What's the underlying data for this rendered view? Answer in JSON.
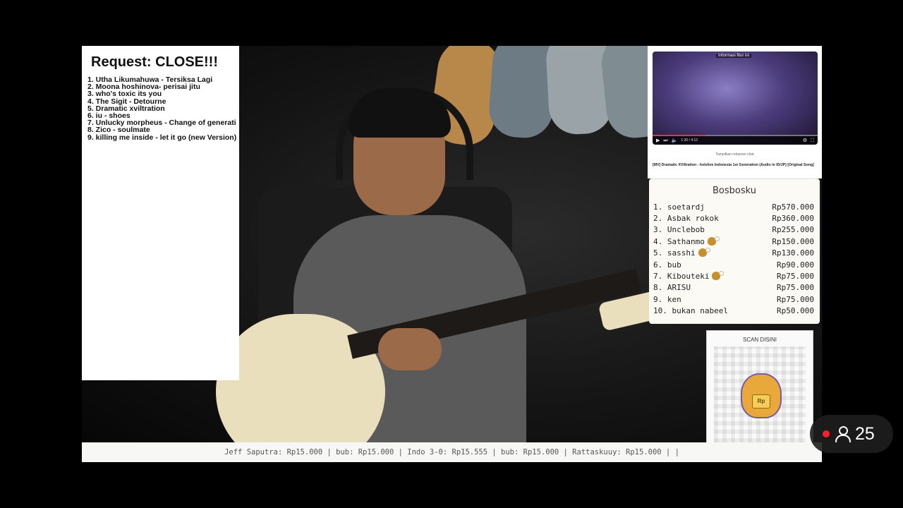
{
  "request": {
    "title": "Request: CLOSE!!!",
    "items": [
      "1. Utha Likumahuwa - Tersiksa Lagi",
      "2. Moona hoshinova- perisai jitu",
      "3. who's toxic its you",
      "4. The Sigit - Detourne",
      "5. Dramatic xviltration",
      "6. iu - shoes",
      "7. Unlucky morpheus - Change of generati",
      "8. Zico - soulmate",
      "9. killing me inside - let it go (new Version)"
    ]
  },
  "video": {
    "top_caption": "Informasi fitur ini",
    "time": "1:30 / 4:12",
    "progress": 0.32,
    "chat_caption": "Tampilkan rekaman chat",
    "title": "[MV] Dramatic XViltration - hololive Indonesia 1st Generation (Audio in ID/JP) [Original Song]"
  },
  "leaderboard": {
    "title": "Bosbosku",
    "rows": [
      {
        "rank": "1.",
        "name": "soetardj",
        "amount": "Rp570.000",
        "badge": false
      },
      {
        "rank": "2.",
        "name": "Asbak rokok",
        "amount": "Rp360.000",
        "badge": false
      },
      {
        "rank": "3.",
        "name": "Unclebob",
        "amount": "Rp255.000",
        "badge": false
      },
      {
        "rank": "4.",
        "name": "Sathanmo",
        "amount": "Rp150.000",
        "badge": true
      },
      {
        "rank": "5.",
        "name": "sasshi",
        "amount": "Rp130.000",
        "badge": true
      },
      {
        "rank": "6.",
        "name": "bub",
        "amount": "Rp90.000",
        "badge": false
      },
      {
        "rank": "7.",
        "name": "Kibouteki",
        "amount": "Rp75.000",
        "badge": true
      },
      {
        "rank": "8.",
        "name": "ARISU",
        "amount": "Rp75.000",
        "badge": false
      },
      {
        "rank": "9.",
        "name": "ken",
        "amount": "Rp75.000",
        "badge": false
      },
      {
        "rank": "10.",
        "name": "bukan nabeel",
        "amount": "Rp50.000",
        "badge": false
      }
    ]
  },
  "qr": {
    "label": "SCAN DISINI",
    "mascot_text": "Rp"
  },
  "ticker": {
    "text": "Jeff Saputra: Rp15.000 | bub: Rp15.000 | Indo 3-0: Rp15.555 | bub: Rp15.000 | Rattaskuuy: Rp15.000 |  |"
  },
  "viewers": {
    "count": "25"
  },
  "colors": {
    "live": "#ff1f2c",
    "panel": "#fbfaf4"
  }
}
